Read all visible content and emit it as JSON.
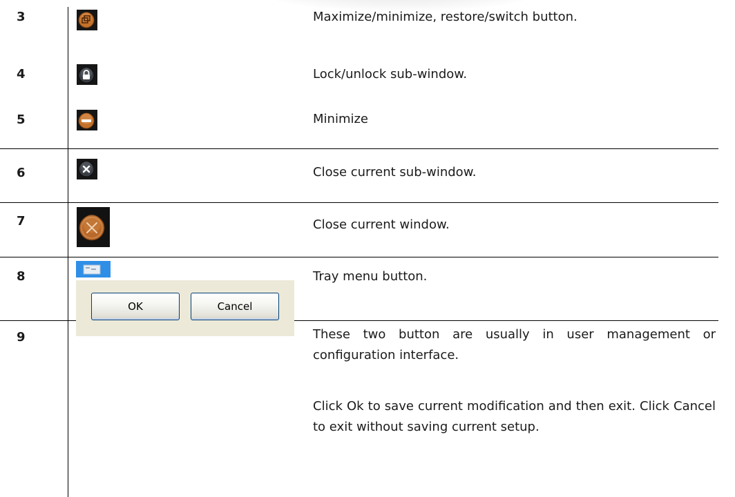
{
  "rows": [
    {
      "number": "3",
      "icon": "restore-switch-icon",
      "description": "Maximize/minimize, restore/switch button."
    },
    {
      "number": "4",
      "icon": "lock-icon",
      "description": "Lock/unlock sub-window."
    },
    {
      "number": "5",
      "icon": "minimize-icon",
      "description": "Minimize"
    },
    {
      "number": "6",
      "icon": "close-subwindow-icon",
      "description": "Close current sub-window."
    },
    {
      "number": "7",
      "icon": "close-window-icon",
      "description": "Close current window."
    },
    {
      "number": "8",
      "icon": "tray-menu-icon",
      "description": "Tray menu button."
    },
    {
      "number": "9",
      "icon": "ok-cancel-buttons",
      "description": "These two button are usually in user management or configuration interface.",
      "note": "Click Ok to save current modification and then exit. Click Cancel to exit without saving current setup."
    }
  ],
  "buttons": {
    "ok_label": "OK",
    "cancel_label": "Cancel"
  },
  "colors": {
    "orange_icon": "#c8762e",
    "dark_icon_bg": "#1a1a1a",
    "tray_blue": "#2f8fe6",
    "xp_panel": "#ece9d8",
    "xp_border": "#003c74"
  }
}
